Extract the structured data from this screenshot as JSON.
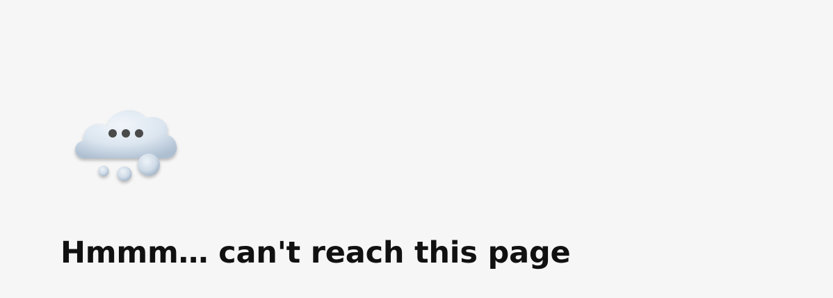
{
  "error_page": {
    "icon": "thinking-cloud-icon",
    "title": "Hmmm… can't reach this page"
  },
  "colors": {
    "background": "#f6f6f6",
    "title_text": "#111111",
    "cloud_light": "#e6eef6",
    "cloud_shade": "#a9b9cb",
    "dots": "#4a4a4a"
  }
}
